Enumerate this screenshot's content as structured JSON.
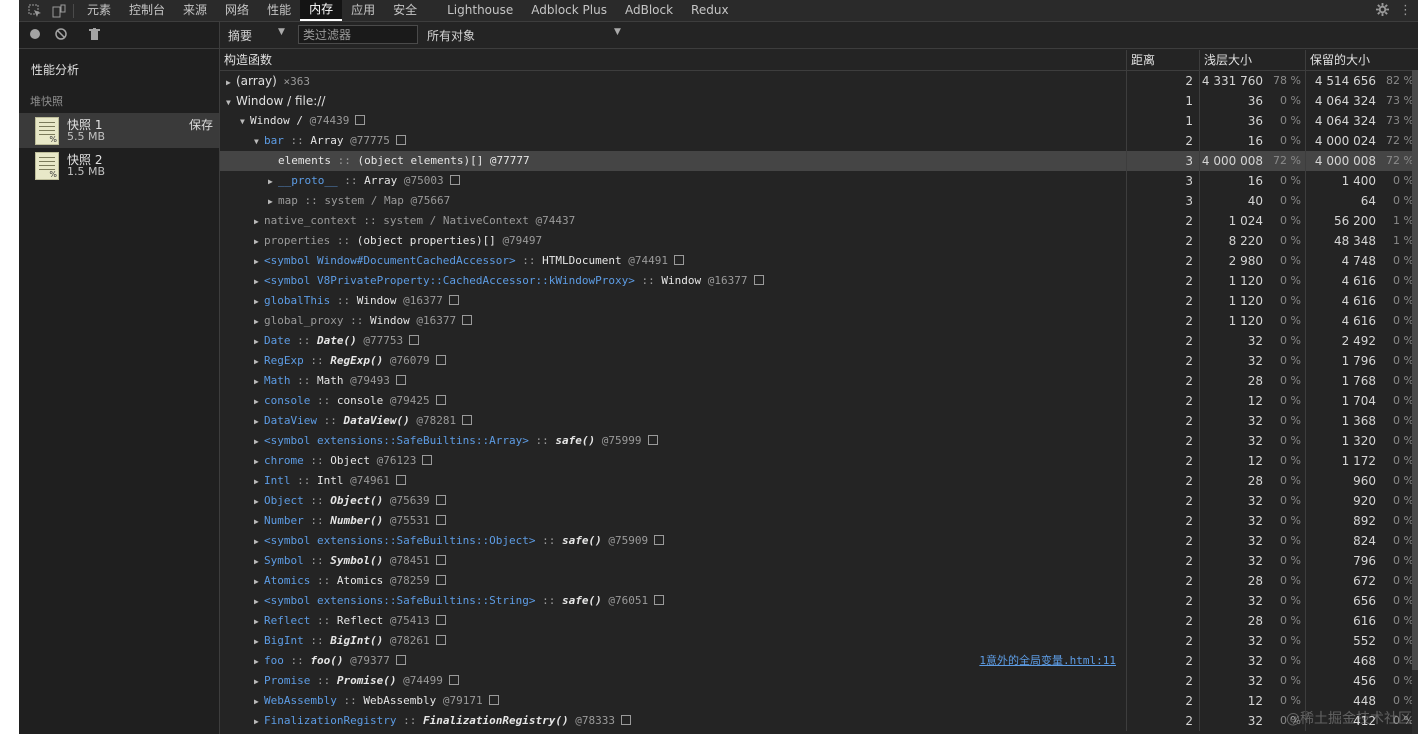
{
  "tabs": [
    "元素",
    "控制台",
    "来源",
    "网络",
    "性能",
    "内存",
    "应用",
    "安全",
    "Lighthouse",
    "Adblock Plus",
    "AdBlock",
    "Redux"
  ],
  "active_tab": 5,
  "sidebar": {
    "title": "性能分析",
    "section": "堆快照",
    "snapshots": [
      {
        "name": "快照 1",
        "size": "5.5 MB",
        "save": "保存"
      },
      {
        "name": "快照 2",
        "size": "1.5 MB"
      }
    ]
  },
  "controls": {
    "summary": "摘要",
    "filter_placeholder": "类过滤器",
    "objects": "所有对象"
  },
  "columns": {
    "constructor": "构造函数",
    "distance": "距离",
    "shallow": "浅层大小",
    "retained": "保留的大小"
  },
  "rows": [
    {
      "indent": 0,
      "tri": "▶",
      "html": "<span class='plain'>(array)</span> <span class='oid'>×363</span>",
      "dist": "2",
      "shallow": "4 331 760",
      "sp": "78 %",
      "ret": "4 514 656",
      "rp": "82 %"
    },
    {
      "indent": 0,
      "tri": "▼",
      "html": "<span class='plain'>Window / file://</span>",
      "dist": "1",
      "shallow": "36",
      "sp": "0 %",
      "ret": "4 064 324",
      "rp": "73 %"
    },
    {
      "indent": 1,
      "tri": "▼",
      "html": "<span class='ctype'>Window /</span> <span class='oid'>@74439</span><span class='box'></span>",
      "dist": "1",
      "shallow": "36",
      "sp": "0 %",
      "ret": "4 064 324",
      "rp": "73 %"
    },
    {
      "indent": 2,
      "tri": "▼",
      "html": "<span class='pname'>bar</span> <span class='sep'>::</span> <span class='ctype'>Array</span> <span class='oid'>@77775</span><span class='box'></span>",
      "dist": "2",
      "shallow": "16",
      "sp": "0 %",
      "ret": "4 000 024",
      "rp": "72 %"
    },
    {
      "indent": 3,
      "tri": "",
      "hl": true,
      "html": "<span class='ctype'>elements</span> <span class='sep'>::</span> <span class='ctype'>(object elements)[] @77777</span>",
      "dist": "3",
      "shallow": "4 000 008",
      "sp": "72 %",
      "ret": "4 000 008",
      "rp": "72 %"
    },
    {
      "indent": 3,
      "tri": "▶",
      "html": "<span class='pname'>__proto__</span> <span class='sep'>::</span> <span class='ctype'>Array</span> <span class='oid'>@75003</span><span class='box'></span>",
      "dist": "3",
      "shallow": "16",
      "sp": "0 %",
      "ret": "1 400",
      "rp": "0 %"
    },
    {
      "indent": 3,
      "tri": "▶",
      "html": "<span class='pname gray'>map</span> <span class='sep'>::</span> <span class='ctype gray'>system / Map</span> <span class='oid'>@75667</span>",
      "dist": "3",
      "shallow": "40",
      "sp": "0 %",
      "ret": "64",
      "rp": "0 %"
    },
    {
      "indent": 2,
      "tri": "▶",
      "html": "<span class='pname gray'>native_context</span> <span class='sep'>::</span> <span class='ctype gray'>system / NativeContext</span> <span class='oid'>@74437</span>",
      "dist": "2",
      "shallow": "1 024",
      "sp": "0 %",
      "ret": "56 200",
      "rp": "1 %"
    },
    {
      "indent": 2,
      "tri": "▶",
      "html": "<span class='pname gray'>properties</span> <span class='sep'>::</span> <span class='ctype'>(object properties)[]</span> <span class='oid'>@79497</span>",
      "dist": "2",
      "shallow": "8 220",
      "sp": "0 %",
      "ret": "48 348",
      "rp": "1 %"
    },
    {
      "indent": 2,
      "tri": "▶",
      "html": "<span class='pname'>&lt;symbol Window#DocumentCachedAccessor&gt;</span> <span class='sep'>::</span> <span class='ctype'>HTMLDocument</span> <span class='oid'>@74491</span><span class='box'></span>",
      "dist": "2",
      "shallow": "2 980",
      "sp": "0 %",
      "ret": "4 748",
      "rp": "0 %"
    },
    {
      "indent": 2,
      "tri": "▶",
      "html": "<span class='pname'>&lt;symbol V8PrivateProperty::CachedAccessor::kWindowProxy&gt;</span> <span class='sep'>::</span> <span class='ctype'>Window</span> <span class='oid'>@16377</span><span class='box'></span>",
      "dist": "2",
      "shallow": "1 120",
      "sp": "0 %",
      "ret": "4 616",
      "rp": "0 %"
    },
    {
      "indent": 2,
      "tri": "▶",
      "html": "<span class='pname'>globalThis</span> <span class='sep'>::</span> <span class='ctype'>Window</span> <span class='oid'>@16377</span><span class='box'></span>",
      "dist": "2",
      "shallow": "1 120",
      "sp": "0 %",
      "ret": "4 616",
      "rp": "0 %"
    },
    {
      "indent": 2,
      "tri": "▶",
      "html": "<span class='pname gray'>global_proxy</span> <span class='sep'>::</span> <span class='ctype'>Window</span> <span class='oid'>@16377</span><span class='box'></span>",
      "dist": "2",
      "shallow": "1 120",
      "sp": "0 %",
      "ret": "4 616",
      "rp": "0 %"
    },
    {
      "indent": 2,
      "tri": "▶",
      "html": "<span class='pname'>Date</span> <span class='sep'>::</span> <span class='ctype it'>Date()</span> <span class='oid'>@77753</span><span class='box'></span>",
      "dist": "2",
      "shallow": "32",
      "sp": "0 %",
      "ret": "2 492",
      "rp": "0 %"
    },
    {
      "indent": 2,
      "tri": "▶",
      "html": "<span class='pname'>RegExp</span> <span class='sep'>::</span> <span class='ctype it'>RegExp()</span> <span class='oid'>@76079</span><span class='box'></span>",
      "dist": "2",
      "shallow": "32",
      "sp": "0 %",
      "ret": "1 796",
      "rp": "0 %"
    },
    {
      "indent": 2,
      "tri": "▶",
      "html": "<span class='pname'>Math</span> <span class='sep'>::</span> <span class='ctype'>Math</span> <span class='oid'>@79493</span><span class='box'></span>",
      "dist": "2",
      "shallow": "28",
      "sp": "0 %",
      "ret": "1 768",
      "rp": "0 %"
    },
    {
      "indent": 2,
      "tri": "▶",
      "html": "<span class='pname'>console</span> <span class='sep'>::</span> <span class='ctype'>console</span> <span class='oid'>@79425</span><span class='box'></span>",
      "dist": "2",
      "shallow": "12",
      "sp": "0 %",
      "ret": "1 704",
      "rp": "0 %"
    },
    {
      "indent": 2,
      "tri": "▶",
      "html": "<span class='pname'>DataView</span> <span class='sep'>::</span> <span class='ctype it'>DataView()</span> <span class='oid'>@78281</span><span class='box'></span>",
      "dist": "2",
      "shallow": "32",
      "sp": "0 %",
      "ret": "1 368",
      "rp": "0 %"
    },
    {
      "indent": 2,
      "tri": "▶",
      "html": "<span class='pname'>&lt;symbol extensions::SafeBuiltins::Array&gt;</span> <span class='sep'>::</span> <span class='ctype it'>safe()</span> <span class='oid'>@75999</span><span class='box'></span>",
      "dist": "2",
      "shallow": "32",
      "sp": "0 %",
      "ret": "1 320",
      "rp": "0 %"
    },
    {
      "indent": 2,
      "tri": "▶",
      "html": "<span class='pname'>chrome</span> <span class='sep'>::</span> <span class='ctype'>Object</span> <span class='oid'>@76123</span><span class='box'></span>",
      "dist": "2",
      "shallow": "12",
      "sp": "0 %",
      "ret": "1 172",
      "rp": "0 %"
    },
    {
      "indent": 2,
      "tri": "▶",
      "html": "<span class='pname'>Intl</span> <span class='sep'>::</span> <span class='ctype'>Intl</span> <span class='oid'>@74961</span><span class='box'></span>",
      "dist": "2",
      "shallow": "28",
      "sp": "0 %",
      "ret": "960",
      "rp": "0 %"
    },
    {
      "indent": 2,
      "tri": "▶",
      "html": "<span class='pname'>Object</span> <span class='sep'>::</span> <span class='ctype it'>Object()</span> <span class='oid'>@75639</span><span class='box'></span>",
      "dist": "2",
      "shallow": "32",
      "sp": "0 %",
      "ret": "920",
      "rp": "0 %"
    },
    {
      "indent": 2,
      "tri": "▶",
      "html": "<span class='pname'>Number</span> <span class='sep'>::</span> <span class='ctype it'>Number()</span> <span class='oid'>@75531</span><span class='box'></span>",
      "dist": "2",
      "shallow": "32",
      "sp": "0 %",
      "ret": "892",
      "rp": "0 %"
    },
    {
      "indent": 2,
      "tri": "▶",
      "html": "<span class='pname'>&lt;symbol extensions::SafeBuiltins::Object&gt;</span> <span class='sep'>::</span> <span class='ctype it'>safe()</span> <span class='oid'>@75909</span><span class='box'></span>",
      "dist": "2",
      "shallow": "32",
      "sp": "0 %",
      "ret": "824",
      "rp": "0 %"
    },
    {
      "indent": 2,
      "tri": "▶",
      "html": "<span class='pname'>Symbol</span> <span class='sep'>::</span> <span class='ctype it'>Symbol()</span> <span class='oid'>@78451</span><span class='box'></span>",
      "dist": "2",
      "shallow": "32",
      "sp": "0 %",
      "ret": "796",
      "rp": "0 %"
    },
    {
      "indent": 2,
      "tri": "▶",
      "html": "<span class='pname'>Atomics</span> <span class='sep'>::</span> <span class='ctype'>Atomics</span> <span class='oid'>@78259</span><span class='box'></span>",
      "dist": "2",
      "shallow": "28",
      "sp": "0 %",
      "ret": "672",
      "rp": "0 %"
    },
    {
      "indent": 2,
      "tri": "▶",
      "html": "<span class='pname'>&lt;symbol extensions::SafeBuiltins::String&gt;</span> <span class='sep'>::</span> <span class='ctype it'>safe()</span> <span class='oid'>@76051</span><span class='box'></span>",
      "dist": "2",
      "shallow": "32",
      "sp": "0 %",
      "ret": "656",
      "rp": "0 %"
    },
    {
      "indent": 2,
      "tri": "▶",
      "html": "<span class='pname'>Reflect</span> <span class='sep'>::</span> <span class='ctype'>Reflect</span> <span class='oid'>@75413</span><span class='box'></span>",
      "dist": "2",
      "shallow": "28",
      "sp": "0 %",
      "ret": "616",
      "rp": "0 %"
    },
    {
      "indent": 2,
      "tri": "▶",
      "html": "<span class='pname'>BigInt</span> <span class='sep'>::</span> <span class='ctype it'>BigInt()</span> <span class='oid'>@78261</span><span class='box'></span>",
      "dist": "2",
      "shallow": "32",
      "sp": "0 %",
      "ret": "552",
      "rp": "0 %"
    },
    {
      "indent": 2,
      "tri": "▶",
      "html": "<span class='pname'>foo</span> <span class='sep'>::</span> <span class='ctype it'>foo()</span> <span class='oid'>@79377</span><span class='box'></span>",
      "link": "1意外的全局变量.html:11",
      "dist": "2",
      "shallow": "32",
      "sp": "0 %",
      "ret": "468",
      "rp": "0 %"
    },
    {
      "indent": 2,
      "tri": "▶",
      "html": "<span class='pname'>Promise</span> <span class='sep'>::</span> <span class='ctype it'>Promise()</span> <span class='oid'>@74499</span><span class='box'></span>",
      "dist": "2",
      "shallow": "32",
      "sp": "0 %",
      "ret": "456",
      "rp": "0 %"
    },
    {
      "indent": 2,
      "tri": "▶",
      "html": "<span class='pname'>WebAssembly</span> <span class='sep'>::</span> <span class='ctype'>WebAssembly</span> <span class='oid'>@79171</span><span class='box'></span>",
      "dist": "2",
      "shallow": "12",
      "sp": "0 %",
      "ret": "448",
      "rp": "0 %"
    },
    {
      "indent": 2,
      "tri": "▶",
      "html": "<span class='pname'>FinalizationRegistry</span> <span class='sep'>::</span> <span class='ctype it'>FinalizationRegistry()</span> <span class='oid'>@78333</span><span class='box'></span>",
      "dist": "2",
      "shallow": "32",
      "sp": "0 %",
      "ret": "412",
      "rp": "0 %"
    }
  ],
  "watermark": "@稀土掘金技术社区"
}
